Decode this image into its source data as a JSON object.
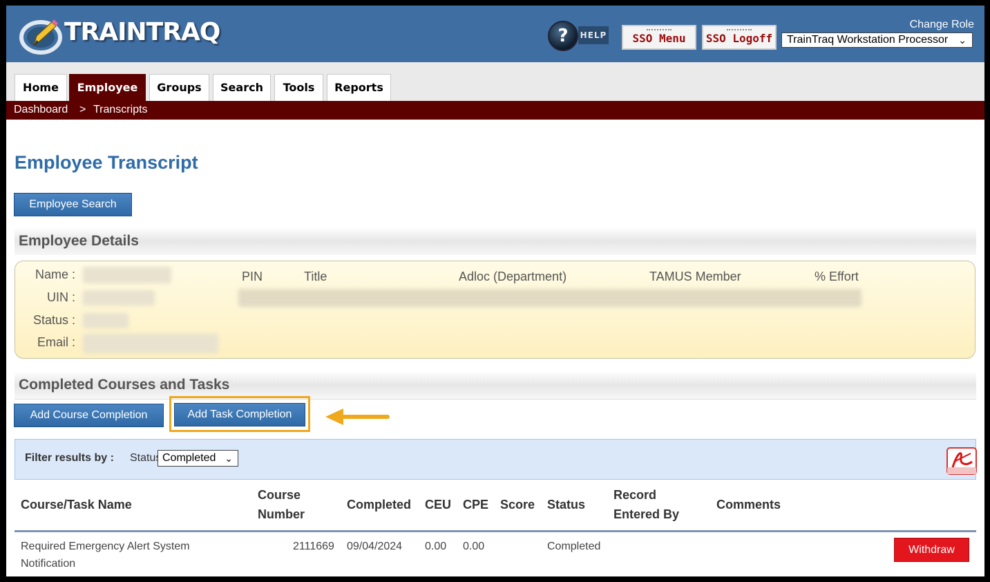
{
  "app": {
    "logo_text": "TRAINTRAQ",
    "help_label": "HELP",
    "help_icon": "?",
    "sso_menu_label": "SSO Menu",
    "sso_logoff_label": "SSO Logoff",
    "change_role_label": "Change Role",
    "role_value": "TrainTraq Workstation Processor"
  },
  "nav": {
    "tabs": [
      {
        "label": "Home",
        "active": false
      },
      {
        "label": "Employee",
        "active": true
      },
      {
        "label": "Groups",
        "active": false
      },
      {
        "label": "Search",
        "active": false
      },
      {
        "label": "Tools",
        "active": false
      },
      {
        "label": "Reports",
        "active": false
      }
    ],
    "breadcrumb": {
      "items": [
        "Dashboard",
        "Transcripts"
      ],
      "separator": ">"
    }
  },
  "page": {
    "title": "Employee Transcript",
    "employee_search_label": "Employee Search"
  },
  "employee_details": {
    "heading": "Employee Details",
    "field_labels": [
      "Name :",
      "UIN :",
      "Status :",
      "Email :"
    ],
    "column_headers": [
      "PIN",
      "Title",
      "Adloc (Department)",
      "TAMUS Member",
      "% Effort"
    ]
  },
  "completed": {
    "heading": "Completed Courses and Tasks",
    "add_course_label": "Add Course Completion",
    "add_task_label": "Add Task Completion",
    "filter_label": "Filter results by :",
    "filter_status_label": "Status",
    "filter_status_value": "Completed",
    "table": {
      "headers": {
        "name": "Course/Task Name",
        "number_1": "Course",
        "number_2": "Number",
        "completed": "Completed",
        "ceu": "CEU",
        "cpe": "CPE",
        "score": "Score",
        "status": "Status",
        "entered_1": "Record",
        "entered_2": "Entered By",
        "comments": "Comments"
      },
      "rows": [
        {
          "name_1": "Required Emergency Alert System",
          "name_2": "Notification",
          "number": "2111669",
          "completed": "09/04/2024",
          "ceu": "0.00",
          "cpe": "0.00",
          "score": "",
          "status": "Completed",
          "entered_by": "",
          "comments": "",
          "action_label": "Withdraw"
        }
      ]
    }
  },
  "colors": {
    "header_blue": "#3f6ea3",
    "maroon": "#5c0000",
    "title_blue": "#2f6ba8",
    "highlight_orange": "#f0a81c",
    "withdraw_red": "#e3151d"
  },
  "icons": [
    "traintraq-logo-icon",
    "help-icon",
    "chevron-down-icon",
    "pdf-icon",
    "arrow-left-icon"
  ]
}
